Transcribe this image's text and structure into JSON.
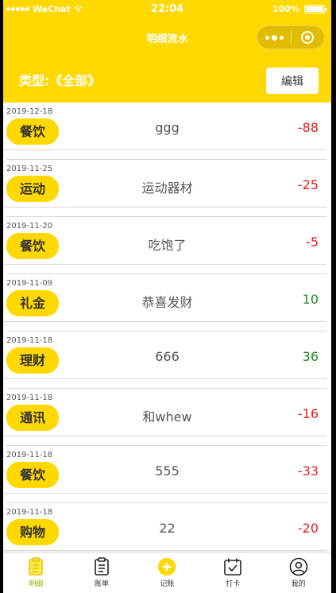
{
  "status_bar": {
    "carrier": "WeChat",
    "time": "22:04",
    "battery_text": "100%"
  },
  "nav": {
    "title": "明细流水"
  },
  "filter": {
    "label": "类型:《全部》",
    "edit_label": "编辑"
  },
  "records": [
    {
      "date": "2019-12-18",
      "category": "餐饮",
      "note": "ggg",
      "amount": "-88",
      "sign": "neg"
    },
    {
      "date": "2019-11-25",
      "category": "运动",
      "note": "运动器材",
      "amount": "-25",
      "sign": "neg"
    },
    {
      "date": "2019-11-20",
      "category": "餐饮",
      "note": "吃饱了",
      "amount": "-5",
      "sign": "neg"
    },
    {
      "date": "2019-11-09",
      "category": "礼金",
      "note": "恭喜发财",
      "amount": "10",
      "sign": "pos"
    },
    {
      "date": "2019-11-18",
      "category": "理财",
      "note": "666",
      "amount": "36",
      "sign": "pos"
    },
    {
      "date": "2019-11-18",
      "category": "通讯",
      "note": "和whew",
      "amount": "-16",
      "sign": "neg"
    },
    {
      "date": "2019-11-18",
      "category": "餐饮",
      "note": "555",
      "amount": "-33",
      "sign": "neg"
    },
    {
      "date": "2019-11-18",
      "category": "购物",
      "note": "22",
      "amount": "-20",
      "sign": "neg"
    }
  ],
  "tabbar": {
    "tabs": [
      {
        "label": "明细",
        "icon": "clipboard-icon",
        "active": true
      },
      {
        "label": "账单",
        "icon": "bill-icon",
        "active": false
      },
      {
        "label": "记账",
        "icon": "add-circle-icon",
        "active": false
      },
      {
        "label": "打卡",
        "icon": "calendar-check-icon",
        "active": false
      },
      {
        "label": "我的",
        "icon": "user-icon",
        "active": false
      }
    ]
  },
  "colors": {
    "accent": "#ffd800",
    "negative": "#e0201f",
    "positive": "#1f8a24",
    "active_tab": "#8fb800"
  }
}
